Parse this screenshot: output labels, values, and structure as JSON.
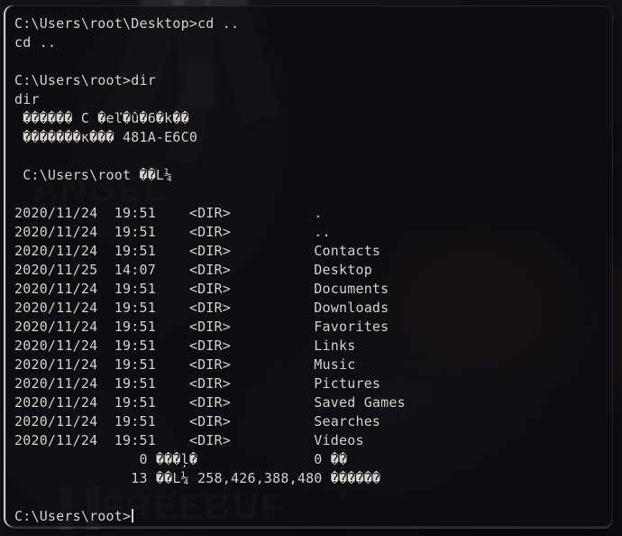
{
  "window": {
    "app": "Windows Command Prompt",
    "background_color": "#0d0c12",
    "text_color": "#d8d4cd",
    "border_color": "#e2e2e4"
  },
  "watermarks": {
    "angel": "ANGEL",
    "freebuf_mark": "▐▐",
    "freebuf": "FREEBUF"
  },
  "console": {
    "lines": [
      "C:\\Users\\root\\Desktop>cd ..",
      "cd ..",
      "",
      "C:\\Users\\root>dir",
      "dir",
      " ������ C �eľ�û�6�k��",
      " �������к��� 481A-E6C0",
      "",
      " C:\\Users\\root ��L¼",
      "",
      "2020/11/24  19:51    <DIR>          .",
      "2020/11/24  19:51    <DIR>          ..",
      "2020/11/24  19:51    <DIR>          Contacts",
      "2020/11/25  14:07    <DIR>          Desktop",
      "2020/11/24  19:51    <DIR>          Documents",
      "2020/11/24  19:51    <DIR>          Downloads",
      "2020/11/24  19:51    <DIR>          Favorites",
      "2020/11/24  19:51    <DIR>          Links",
      "2020/11/24  19:51    <DIR>          Music",
      "2020/11/24  19:51    <DIR>          Pictures",
      "2020/11/24  19:51    <DIR>          Saved Games",
      "2020/11/24  19:51    <DIR>          Searches",
      "2020/11/24  19:51    <DIR>          Videos",
      "               0 ���ļ�              0 ��",
      "              13 ��L¼ 258,426,388,480 ������",
      ""
    ],
    "prompt": "C:\\Users\\root>",
    "cursor": "|"
  }
}
